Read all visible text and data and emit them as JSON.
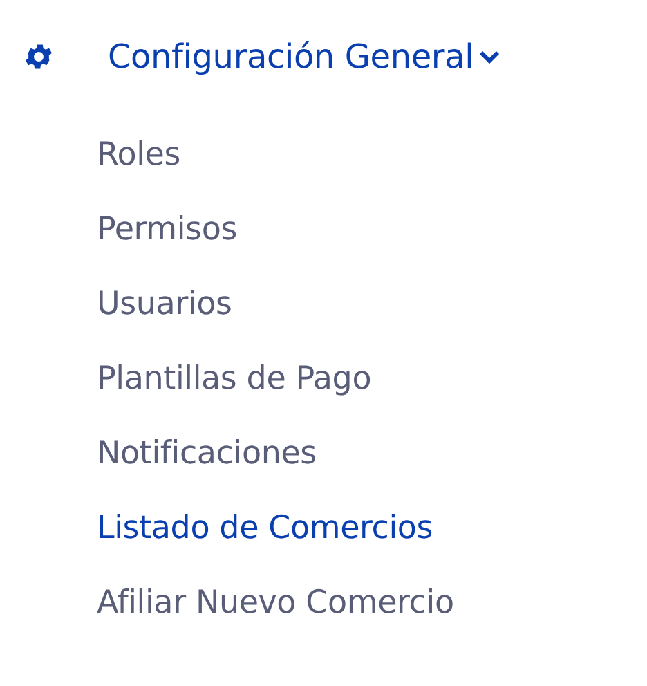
{
  "menu": {
    "title": "Configuración General",
    "expanded": true,
    "items": [
      {
        "label": "Roles",
        "selected": false
      },
      {
        "label": "Permisos",
        "selected": false
      },
      {
        "label": "Usuarios",
        "selected": false
      },
      {
        "label": "Plantillas de Pago",
        "selected": false
      },
      {
        "label": "Notificaciones",
        "selected": false
      },
      {
        "label": "Listado de Comercios",
        "selected": true
      },
      {
        "label": "Afiliar Nuevo Comercio",
        "selected": false
      }
    ]
  }
}
